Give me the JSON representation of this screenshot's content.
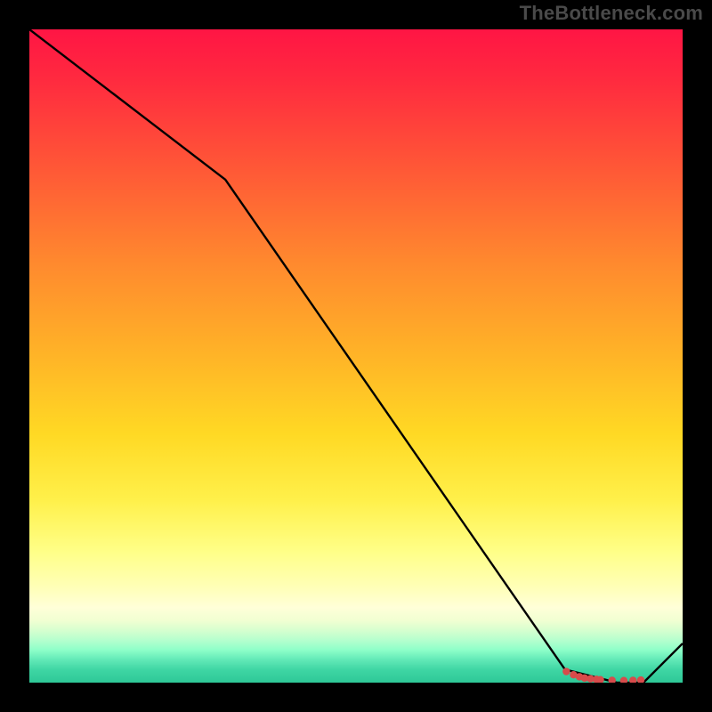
{
  "attribution": "TheBottleneck.com",
  "chart_data": {
    "type": "line",
    "title": "",
    "xlabel": "",
    "ylabel": "",
    "xlim": [
      0,
      100
    ],
    "ylim": [
      0,
      100
    ],
    "series": [
      {
        "name": "curve",
        "x": [
          0,
          30,
          82,
          90,
          94,
          100
        ],
        "values": [
          100,
          77,
          2,
          0,
          0,
          6
        ]
      }
    ],
    "markers": {
      "name": "highlight-points",
      "x": [
        82.2,
        83.3,
        84.2,
        85.0,
        85.9,
        86.8,
        87.4,
        89.2,
        91.0,
        92.4,
        93.6
      ],
      "values": [
        1.7,
        1.2,
        0.9,
        0.7,
        0.6,
        0.5,
        0.45,
        0.35,
        0.31,
        0.34,
        0.4
      ],
      "color": "#d74b4b"
    },
    "gradient_stops": [
      {
        "pos": 0.0,
        "color": "#ff1544"
      },
      {
        "pos": 0.36,
        "color": "#ff8a2e"
      },
      {
        "pos": 0.62,
        "color": "#ffd924"
      },
      {
        "pos": 0.88,
        "color": "#ffffc8"
      },
      {
        "pos": 1.0,
        "color": "#2ec897"
      }
    ]
  }
}
